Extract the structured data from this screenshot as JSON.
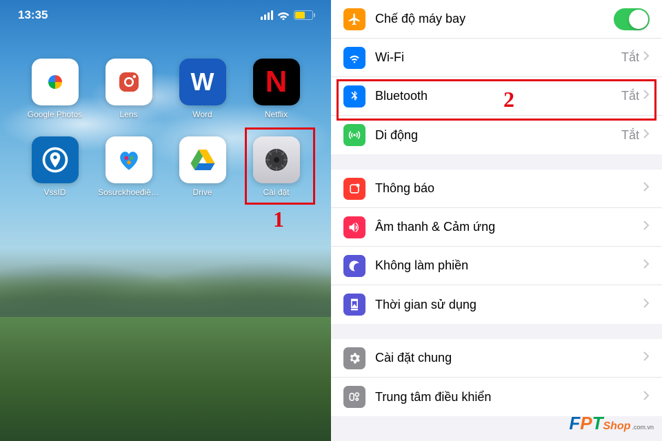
{
  "statusbar": {
    "time": "13:35"
  },
  "apps": [
    {
      "label": "Google Photos",
      "id": "google-photos"
    },
    {
      "label": "Lens",
      "id": "lens"
    },
    {
      "label": "Word",
      "id": "word"
    },
    {
      "label": "Netflix",
      "id": "netflix"
    },
    {
      "label": "VssID",
      "id": "vssid"
    },
    {
      "label": "Sosứckhoeđiệ…",
      "id": "so-suc-khoe"
    },
    {
      "label": "Drive",
      "id": "drive"
    },
    {
      "label": "Cài đặt",
      "id": "settings"
    }
  ],
  "annotations": {
    "step1": "1",
    "step2": "2"
  },
  "settings": {
    "group1": [
      {
        "icon": "airplane",
        "color": "#ff9500",
        "label": "Chế độ máy bay",
        "toggle": true
      },
      {
        "icon": "wifi",
        "color": "#007aff",
        "label": "Wi-Fi",
        "value": "Tắt"
      },
      {
        "icon": "bluetooth",
        "color": "#007aff",
        "label": "Bluetooth",
        "value": "Tắt",
        "highlighted": true
      },
      {
        "icon": "cellular",
        "color": "#34c759",
        "label": "Di động",
        "value": "Tắt"
      }
    ],
    "group2": [
      {
        "icon": "notification",
        "color": "#ff3b30",
        "label": "Thông báo"
      },
      {
        "icon": "sound",
        "color": "#ff2d55",
        "label": "Âm thanh & Cảm ứng"
      },
      {
        "icon": "dnd",
        "color": "#5856d6",
        "label": "Không làm phiền"
      },
      {
        "icon": "screentime",
        "color": "#5856d6",
        "label": "Thời gian sử dụng"
      }
    ],
    "group3": [
      {
        "icon": "general",
        "color": "#8e8e93",
        "label": "Cài đặt chung"
      },
      {
        "icon": "control",
        "color": "#8e8e93",
        "label": "Trung tâm điều khiển"
      }
    ]
  },
  "brand": {
    "f": "F",
    "p": "P",
    "t": "T",
    "shop": "Shop",
    "domain": ".com.vn"
  }
}
